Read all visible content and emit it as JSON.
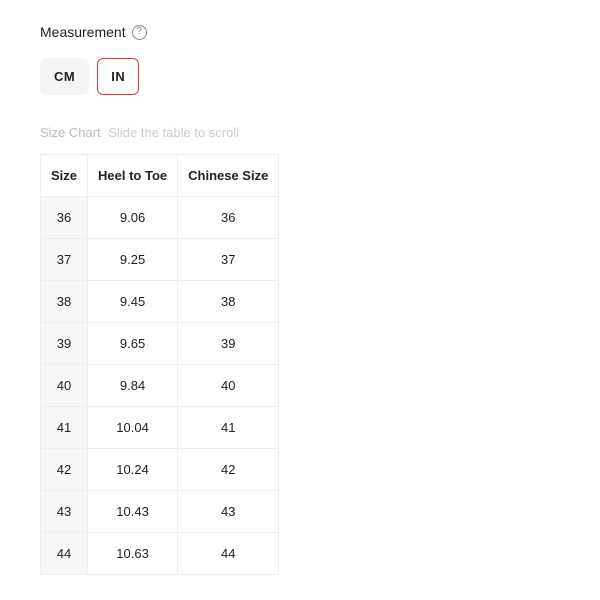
{
  "header": {
    "measurement_label": "Measurement"
  },
  "units": {
    "cm_label": "CM",
    "in_label": "IN",
    "active": "IN"
  },
  "chart": {
    "label": "Size Chart",
    "hint": "Slide the table to scroll",
    "columns": [
      "Size",
      "Heel to Toe",
      "Chinese Size"
    ],
    "rows": [
      {
        "size": "36",
        "heel_to_toe": "9.06",
        "chinese_size": "36"
      },
      {
        "size": "37",
        "heel_to_toe": "9.25",
        "chinese_size": "37"
      },
      {
        "size": "38",
        "heel_to_toe": "9.45",
        "chinese_size": "38"
      },
      {
        "size": "39",
        "heel_to_toe": "9.65",
        "chinese_size": "39"
      },
      {
        "size": "40",
        "heel_to_toe": "9.84",
        "chinese_size": "40"
      },
      {
        "size": "41",
        "heel_to_toe": "10.04",
        "chinese_size": "41"
      },
      {
        "size": "42",
        "heel_to_toe": "10.24",
        "chinese_size": "42"
      },
      {
        "size": "43",
        "heel_to_toe": "10.43",
        "chinese_size": "43"
      },
      {
        "size": "44",
        "heel_to_toe": "10.63",
        "chinese_size": "44"
      }
    ]
  }
}
